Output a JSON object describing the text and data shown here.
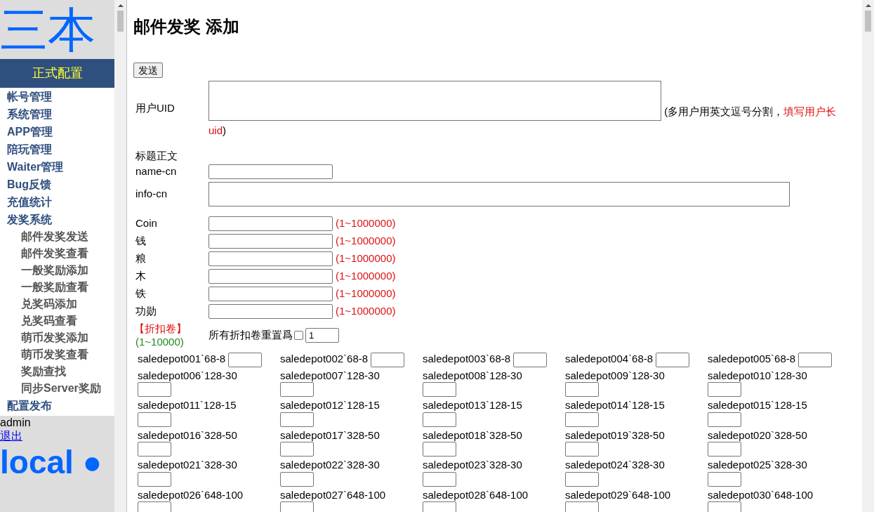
{
  "sidebar": {
    "logo": "三本",
    "section_header": "正式配置",
    "nav": [
      {
        "label": "帐号管理"
      },
      {
        "label": "系统管理"
      },
      {
        "label": "APP管理"
      },
      {
        "label": "陪玩管理"
      },
      {
        "label": "Waiter管理"
      },
      {
        "label": "Bug反馈"
      },
      {
        "label": "充值统计"
      },
      {
        "label": "发奖系统",
        "children": [
          {
            "label": "邮件发奖发送"
          },
          {
            "label": "邮件发奖查看"
          },
          {
            "label": "一般奖励添加"
          },
          {
            "label": "一般奖励查看"
          },
          {
            "label": "兑奖码添加"
          },
          {
            "label": "兑奖码查看"
          },
          {
            "label": "萌币发奖添加"
          },
          {
            "label": "萌币发奖查看"
          },
          {
            "label": "奖励查找"
          },
          {
            "label": "同步Server奖励"
          }
        ]
      },
      {
        "label": "配置发布"
      }
    ],
    "user": "admin",
    "logout": "退出",
    "footer_logo": "local ●"
  },
  "main": {
    "title": "邮件发奖 添加",
    "send_button": "发送",
    "uid": {
      "label": "用户UID",
      "note": "(多用户用英文逗号分割，",
      "note_red": "填写用户长uid",
      "note_end": ")"
    },
    "section_label": "标题正文",
    "name_field": {
      "label": "name-cn"
    },
    "info_field": {
      "label": "info-cn"
    },
    "resources": [
      {
        "label": "Coin",
        "range": "(1~1000000)"
      },
      {
        "label": "钱",
        "range": "(1~1000000)"
      },
      {
        "label": "粮",
        "range": "(1~1000000)"
      },
      {
        "label": "木",
        "range": "(1~1000000)"
      },
      {
        "label": "铁",
        "range": "(1~1000000)"
      },
      {
        "label": "功勋",
        "range": "(1~1000000)"
      }
    ],
    "discount": {
      "label": "【折扣卷】",
      "range": "(1~10000)",
      "reset_label": "所有折扣卷重置爲",
      "reset_checked": false,
      "reset_value": "1"
    },
    "depots": [
      "saledepot001`68-8",
      "saledepot002`68-8",
      "saledepot003`68-8",
      "saledepot004`68-8",
      "saledepot005`68-8",
      "saledepot006`128-30",
      "saledepot007`128-30",
      "saledepot008`128-30",
      "saledepot009`128-30",
      "saledepot010`128-30",
      "saledepot011`128-15",
      "saledepot012`128-15",
      "saledepot013`128-15",
      "saledepot014`128-15",
      "saledepot015`128-15",
      "saledepot016`328-50",
      "saledepot017`328-50",
      "saledepot018`328-50",
      "saledepot019`328-50",
      "saledepot020`328-50",
      "saledepot021`328-30",
      "saledepot022`328-30",
      "saledepot023`328-30",
      "saledepot024`328-30",
      "saledepot025`328-30",
      "saledepot026`648-100",
      "saledepot027`648-100",
      "saledepot028`648-100",
      "saledepot029`648-100",
      "saledepot030`648-100"
    ]
  }
}
